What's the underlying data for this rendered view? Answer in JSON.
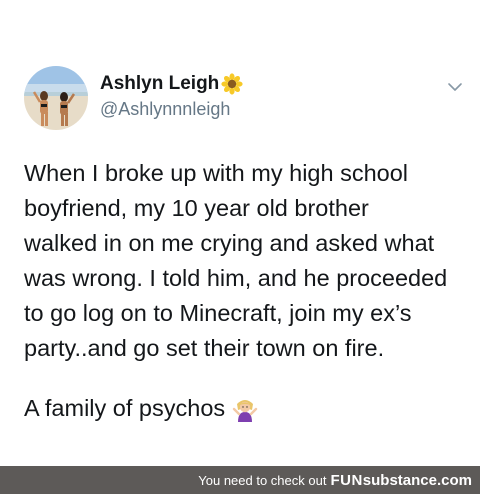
{
  "tweet": {
    "author": {
      "display_name": "Ashlyn Leigh",
      "handle": "@Ashlynnnleigh",
      "name_emoji_icon": "sunflower-icon"
    },
    "menu_icon": "chevron-down-icon",
    "text_lines": [
      "When I broke up with my high school",
      "boyfriend, my 10 year old brother",
      "walked in on me crying and asked what",
      "was wrong. I told him, and he proceeded",
      "to go log on to Minecraft, join my ex’s",
      "party..and go set their town on fire."
    ],
    "footer_text": "A family of psychos",
    "footer_emoji_icon": "person-shrugging-icon"
  },
  "watermark": {
    "text": "You need to check out",
    "logo_fun": "FUN",
    "logo_rest": "substance.com"
  },
  "colors": {
    "text": "#14171a",
    "handle": "#657786",
    "watermark_bg": "#5d5a58"
  }
}
